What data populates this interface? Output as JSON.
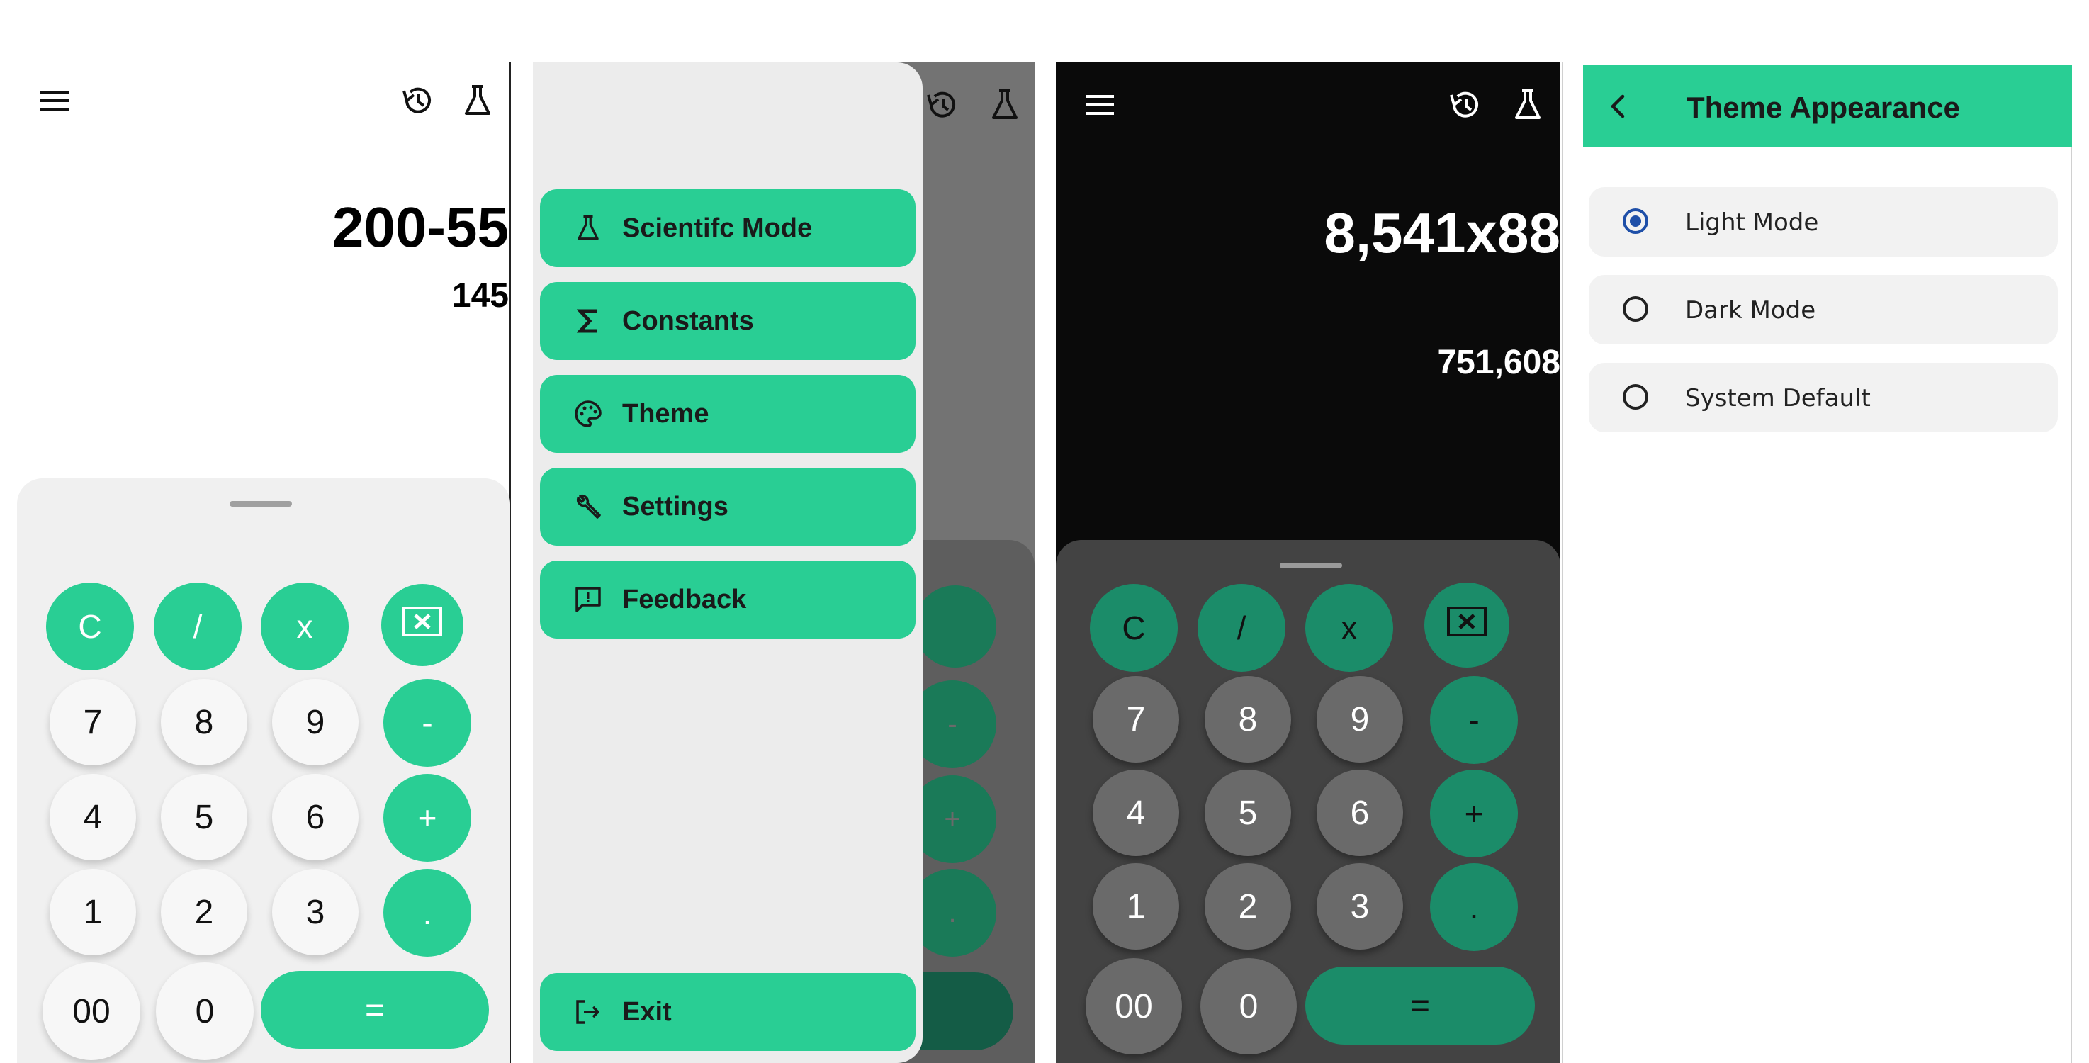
{
  "light_calc": {
    "expression": "200-55",
    "result": "145",
    "icons": [
      "menu-icon",
      "history-icon",
      "flask-icon"
    ],
    "row1": [
      "C",
      "/",
      "x"
    ],
    "keys": [
      "7",
      "8",
      "9",
      "-",
      "4",
      "5",
      "6",
      "+",
      "1",
      "2",
      "3",
      "."
    ],
    "bottom": [
      "00",
      "0",
      "="
    ]
  },
  "drawer": {
    "items": [
      {
        "label": "Scientifc Mode",
        "icon": "flask-icon"
      },
      {
        "label": "Constants",
        "icon": "sigma-icon"
      },
      {
        "label": "Theme",
        "icon": "palette-icon"
      },
      {
        "label": "Settings",
        "icon": "wrench-icon"
      },
      {
        "label": "Feedback",
        "icon": "feedback-icon"
      }
    ],
    "exit_label": "Exit",
    "dim_keys": [
      "-",
      "+",
      "."
    ]
  },
  "dark_calc": {
    "expression": "8,541x88",
    "result": "751,608",
    "row1": [
      "C",
      "/",
      "x"
    ],
    "keys": [
      "7",
      "8",
      "9",
      "-",
      "4",
      "5",
      "6",
      "+",
      "1",
      "2",
      "3",
      "."
    ],
    "bottom": [
      "00",
      "0",
      "="
    ]
  },
  "theme_settings": {
    "title": "Theme Appearance",
    "options": [
      {
        "label": "Light Mode",
        "selected": true
      },
      {
        "label": "Dark Mode",
        "selected": false
      },
      {
        "label": "System Default",
        "selected": false
      }
    ]
  },
  "colors": {
    "accent": "#29ce94",
    "accent_dark": "#1b8c69",
    "radio_selected": "#1e4fa8"
  }
}
